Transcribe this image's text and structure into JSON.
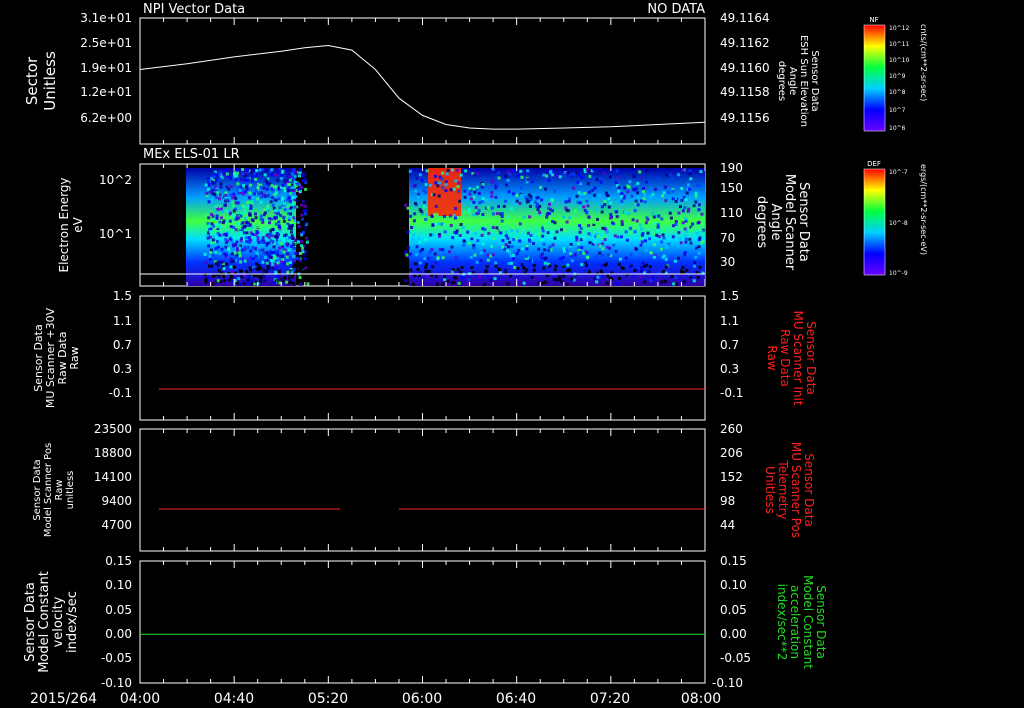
{
  "date_label": "2015/264",
  "x_ticks": [
    "04:00",
    "04:40",
    "05:20",
    "06:00",
    "06:40",
    "07:20",
    "08:00"
  ],
  "colors": {
    "white": "#ffffff",
    "red": "#ff2020",
    "green": "#22dd22"
  },
  "chart_data": [
    {
      "type": "line",
      "title_left": "NPI Vector Data",
      "title_right": "NO DATA",
      "ylabel_left": "Sector\nUnitless",
      "ylabel_right": "Sensor Data\nESH Sun Elevation\nAngle\ndegrees",
      "yticks_left": [
        "3.1e+01",
        "2.5e+01",
        "1.9e+01",
        "1.2e+01",
        "6.2e+00"
      ],
      "yticks_right": [
        "49.1164",
        "49.1162",
        "49.1160",
        "49.1158",
        "49.1156"
      ],
      "ylim_right": [
        49.1154,
        49.1165
      ],
      "series": [
        {
          "color": "#ffffff",
          "x": [
            "04:00",
            "04:20",
            "04:40",
            "05:00",
            "05:10",
            "05:20",
            "05:30",
            "05:40",
            "05:50",
            "06:00",
            "06:10",
            "06:20",
            "06:30",
            "06:40",
            "07:00",
            "07:20",
            "07:40",
            "08:00"
          ],
          "y": [
            49.11605,
            49.1161,
            49.11616,
            49.11621,
            49.11624,
            49.11626,
            49.11622,
            49.11605,
            49.1158,
            49.11565,
            49.11557,
            49.11554,
            49.11553,
            49.11553,
            49.11554,
            49.11555,
            49.11557,
            49.11559
          ]
        }
      ],
      "colorbar": {
        "label": "NF",
        "units": "cnts/(cm**2-sr-sec)",
        "ticks": [
          "10^12",
          "10^11",
          "10^10",
          "10^9",
          "10^8",
          "10^7",
          "10^6"
        ]
      }
    },
    {
      "type": "heatmap",
      "title_left": "MEx ELS-01 LR",
      "ylabel_left": "Electron Energy\neV",
      "ylabel_right": "Sensor Data\nModel Scanner\nAngle\ndegrees",
      "yticks_left": [
        "10^2",
        "10^1"
      ],
      "yticks_right": [
        "190",
        "150",
        "110",
        "70",
        "30"
      ],
      "data_blocks": [
        [
          "04:27",
          "05:12"
        ],
        [
          "05:52",
          "08:00"
        ]
      ],
      "hot_region": [
        "06:08",
        "06:22"
      ],
      "colorbar": {
        "label": "DEF",
        "units": "ergs/(cm**2-sr-sec-eV)",
        "ticks": [
          "10^-7",
          "10^-8",
          "10^-9"
        ]
      }
    },
    {
      "type": "line",
      "ylabel_left": "Sensor Data\nMU Scanner +30V\nRaw Data\nRaw",
      "ylabel_right": "Sensor Data\nMU Scanner Init\nRaw Data\nRaw",
      "yticks_left": [
        "1.5",
        "1.1",
        "0.7",
        "0.3",
        "-0.1"
      ],
      "yticks_right": [
        "1.5",
        "1.1",
        "0.7",
        "0.3",
        "-0.1"
      ],
      "ylim": [
        -0.5,
        1.5
      ],
      "series": [
        {
          "color": "#ff2020",
          "segments": [
            {
              "x": [
                "04:08",
                "08:00"
              ],
              "y": 0.0
            }
          ]
        }
      ]
    },
    {
      "type": "line",
      "ylabel_left": "Sensor Data\nModel Scanner Pos\nRaw\nunitless",
      "ylabel_right": "Sensor Data\nMU Scanner Pos\nTelemetry\nUnitless",
      "yticks_left": [
        "23500",
        "18800",
        "14100",
        "9400",
        "4700"
      ],
      "yticks_right": [
        "260",
        "206",
        "152",
        "98",
        "44"
      ],
      "ylim": [
        0,
        23500
      ],
      "series": [
        {
          "color": "#ff2020",
          "segments": [
            {
              "x": [
                "04:08",
                "05:25"
              ],
              "y": 8100
            },
            {
              "x": [
                "05:50",
                "08:00"
              ],
              "y": 8100
            }
          ]
        }
      ]
    },
    {
      "type": "line",
      "ylabel_left": "Sensor Data\nModel Constant\nvelocity\nindex/sec",
      "ylabel_right": "Sensor Data\nModel Constant\nacceleration\nindex/sec**2",
      "yticks_left": [
        "0.15",
        "0.10",
        "0.05",
        "0.00",
        "-0.05",
        "-0.10"
      ],
      "yticks_right": [
        "0.15",
        "0.10",
        "0.05",
        "0.00",
        "-0.05",
        "-0.10"
      ],
      "ylim": [
        -0.1,
        0.15
      ],
      "series": [
        {
          "color": "#22dd22",
          "segments": [
            {
              "x": [
                "04:00",
                "08:00"
              ],
              "y": 0.0
            }
          ]
        }
      ]
    }
  ]
}
